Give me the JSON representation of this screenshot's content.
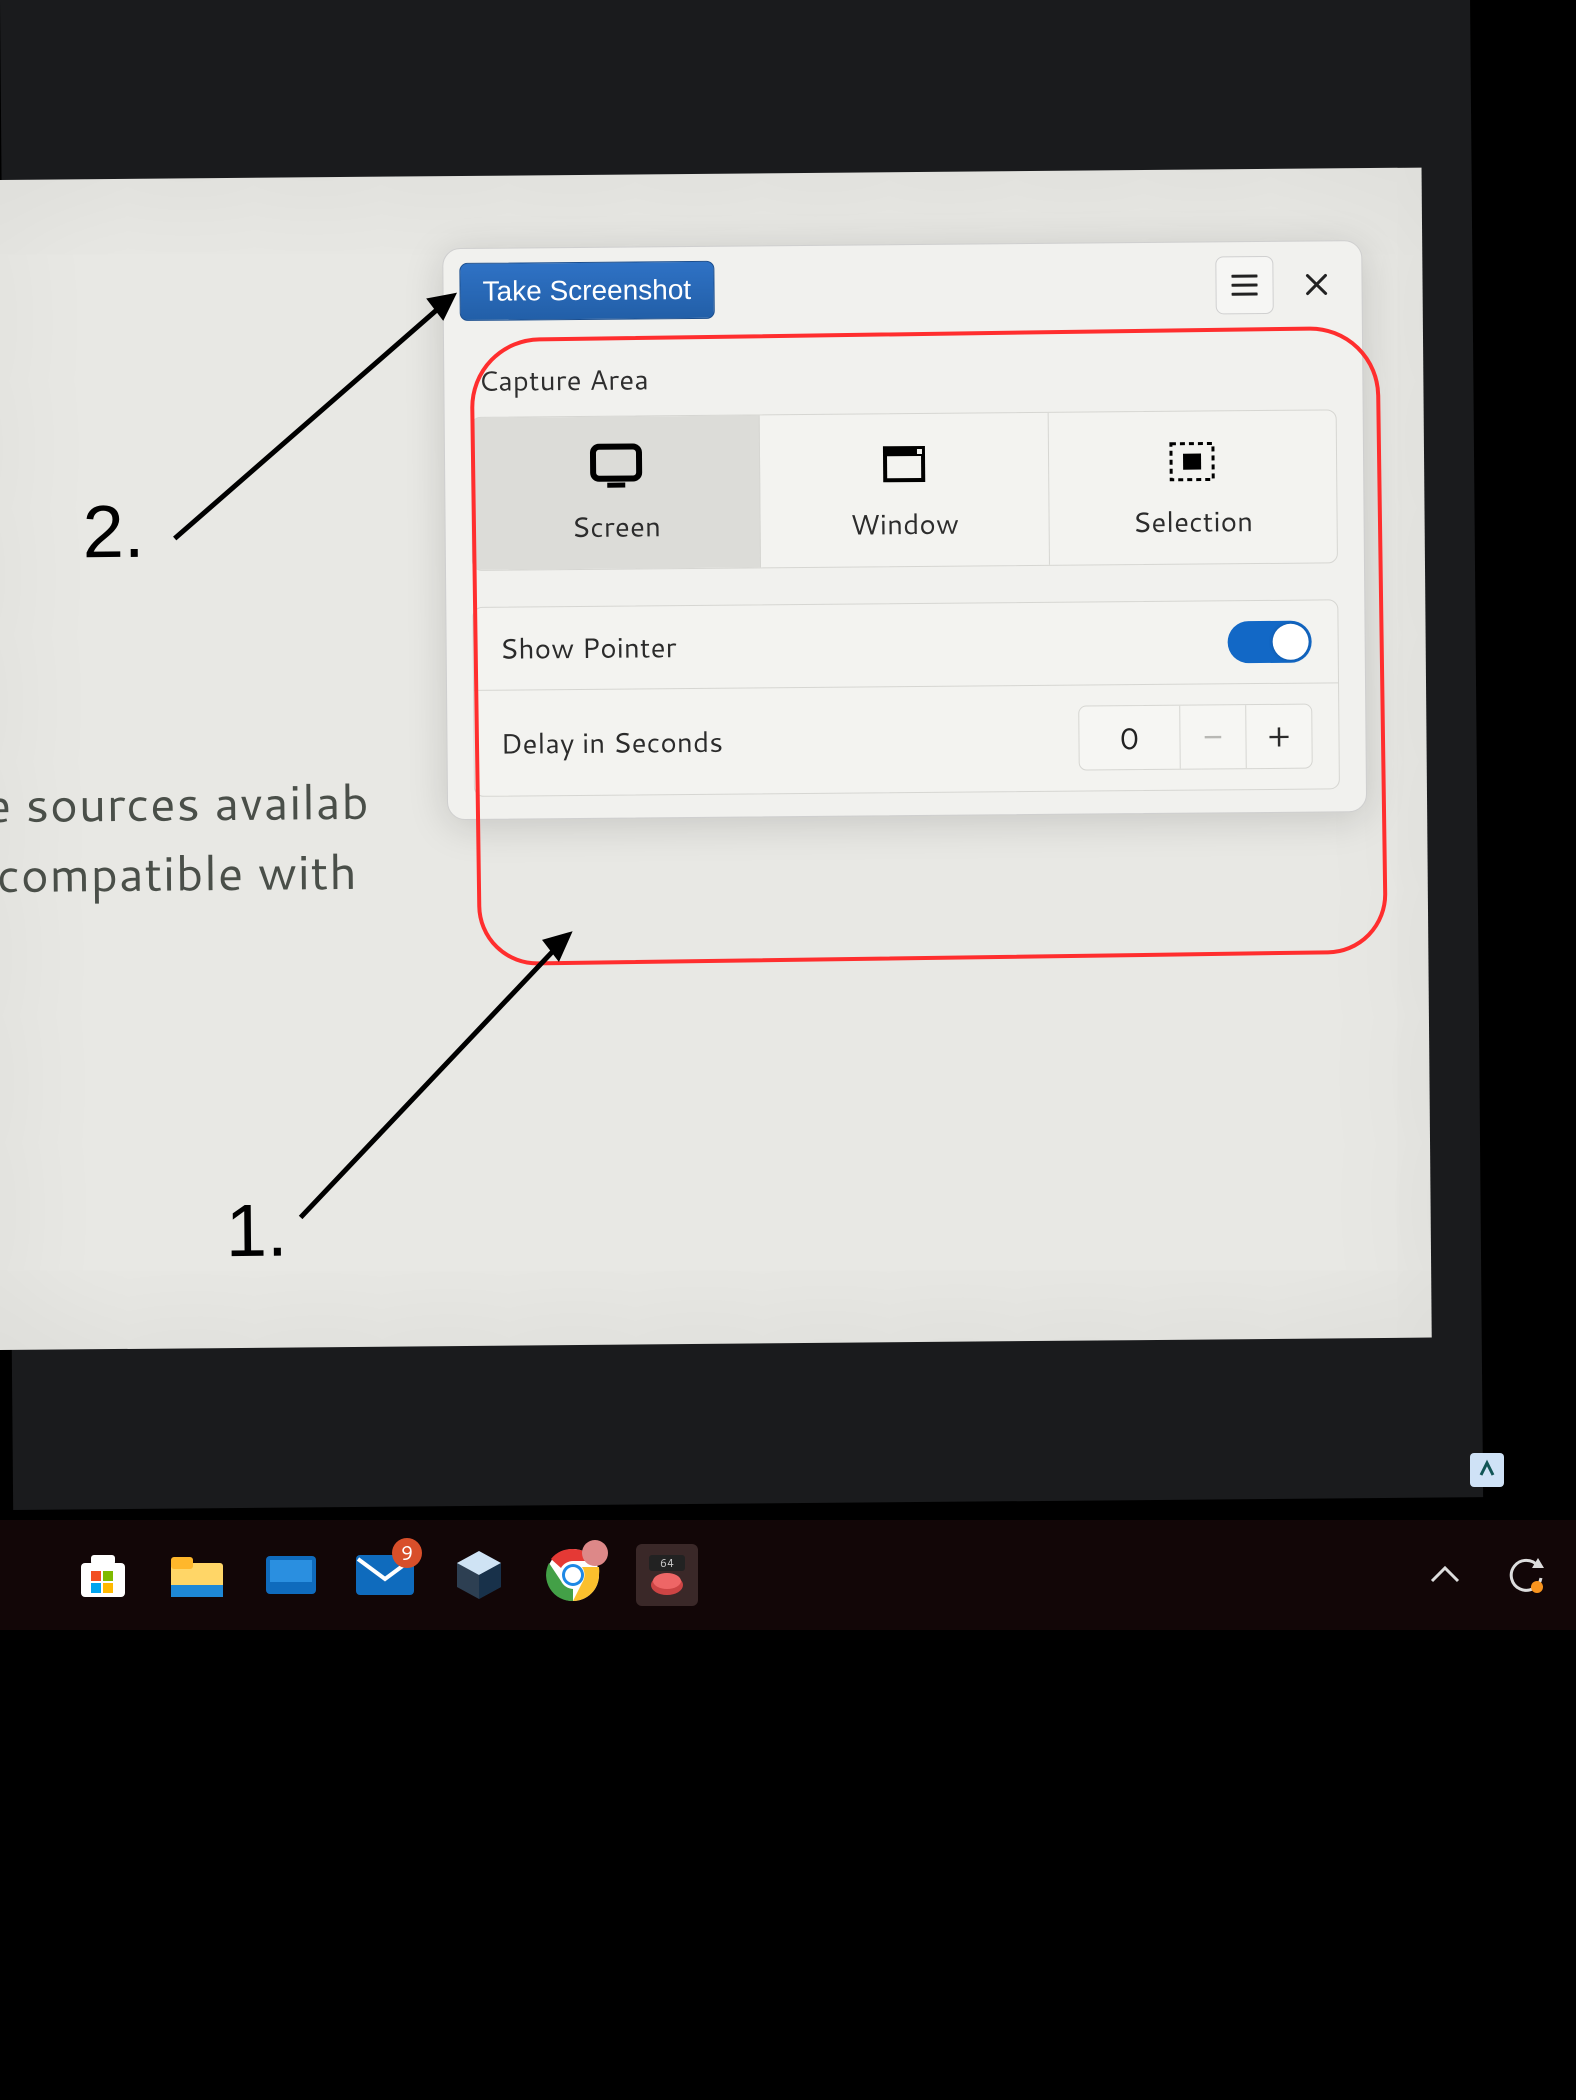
{
  "background_text": {
    "line1": "he sources availab",
    "line2": "y compatible with"
  },
  "dialog": {
    "title_button": "Take Screenshot",
    "section_label": "Capture Area",
    "options": {
      "screen": "Screen",
      "window": "Window",
      "selection": "Selection"
    },
    "show_pointer_label": "Show Pointer",
    "show_pointer_on": true,
    "delay_label": "Delay in Seconds",
    "delay_value": "0"
  },
  "annotations": {
    "step1": "1.",
    "step2": "2."
  },
  "taskbar": {
    "mail_badge": "9"
  }
}
